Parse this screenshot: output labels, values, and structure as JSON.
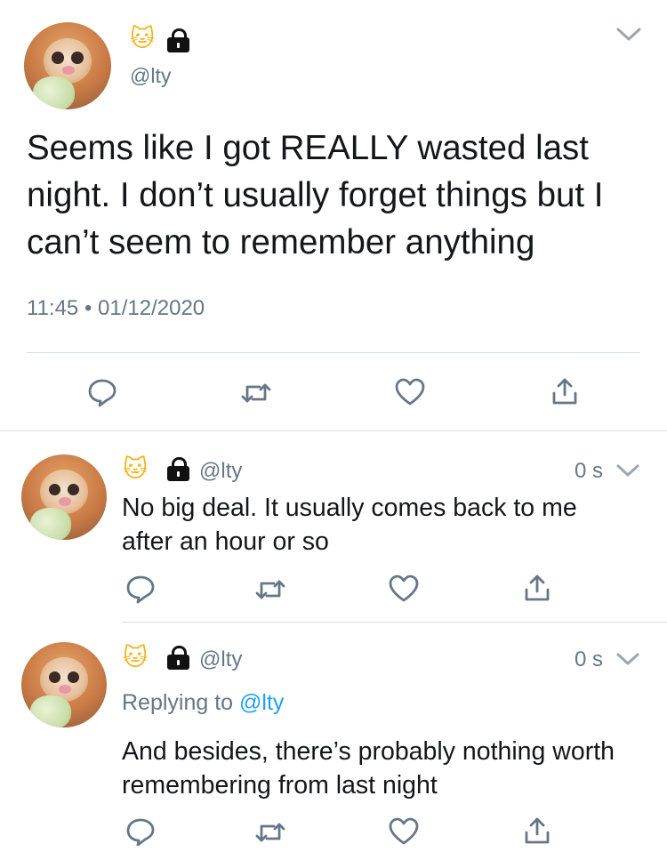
{
  "main_tweet": {
    "handle": "@lty",
    "name_emoji": "🐱",
    "text": "Seems like I got REALLY wasted last night. I don’t usually forget things but I can’t seem to remember anything",
    "timestamp": "11:45 • 01/12/2020",
    "icons": [
      "cat-emoji",
      "lock-icon",
      "chevron-down-icon",
      "reply-icon",
      "retweet-icon",
      "like-icon",
      "share-icon"
    ]
  },
  "replies": [
    {
      "handle": "@lty",
      "time": "0 s",
      "text": "No big deal. It usually comes back to me after an hour or so"
    },
    {
      "handle": "@lty",
      "time": "0 s",
      "replying_prefix": "Replying to",
      "replying_handle": "@lty",
      "text": "And besides, there’s probably nothing worth remembering from last night"
    }
  ],
  "colors": {
    "accent": "#1da1f2",
    "muted": "#657786",
    "text": "#14171a",
    "divider": "#d9dee2"
  }
}
